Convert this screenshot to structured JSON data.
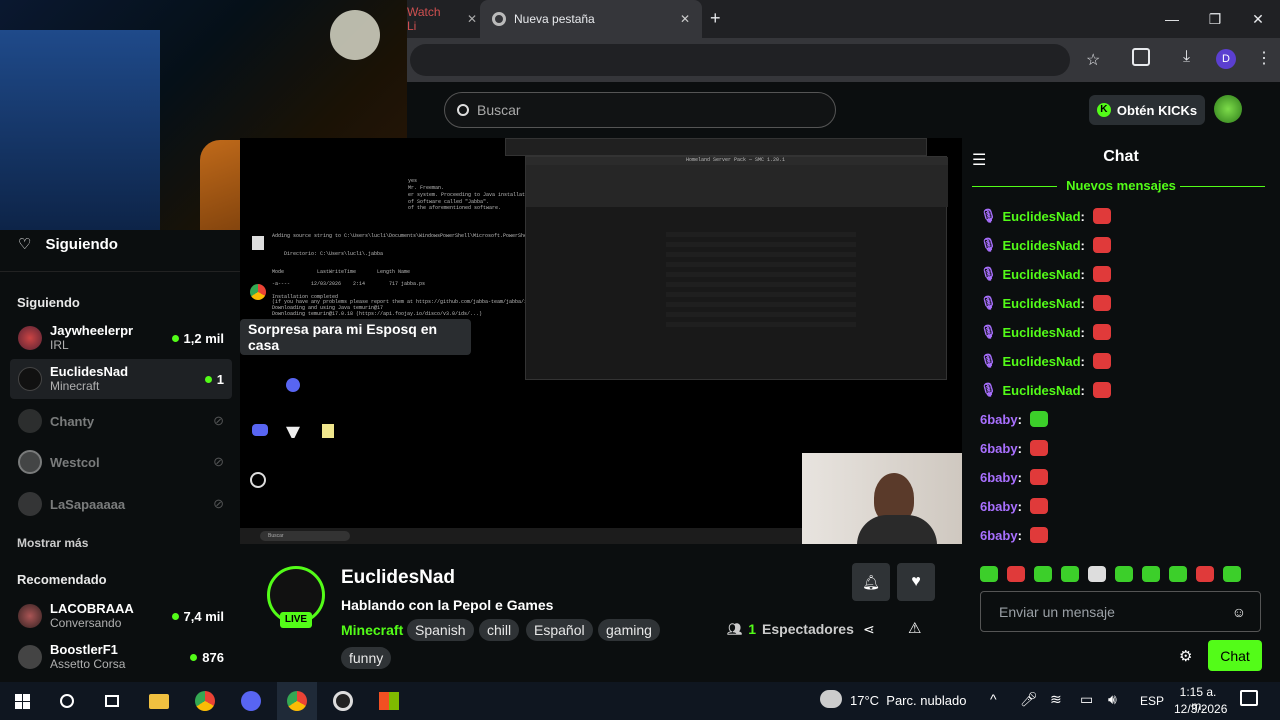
{
  "browser": {
    "tabs": [
      {
        "label": "Watch Li"
      },
      {
        "label": "Nueva pestaña"
      }
    ],
    "profile_initial": "D"
  },
  "header": {
    "search_placeholder": "Buscar",
    "get_kicks_label": "Obtén KICKs"
  },
  "sidebar": {
    "following_header": "Siguiendo",
    "following_section": "Siguiendo",
    "following": [
      {
        "name": "Jaywheelerpr",
        "category": "IRL",
        "viewers": "1,2 mil",
        "live": true
      },
      {
        "name": "EuclidesNad",
        "category": "Minecraft",
        "viewers": "1",
        "live": true
      },
      {
        "name": "Chanty",
        "category": "",
        "viewers": "",
        "live": false
      },
      {
        "name": "Westcol",
        "category": "",
        "viewers": "",
        "live": false
      },
      {
        "name": "LaSapaaaaa",
        "category": "",
        "viewers": "",
        "live": false
      }
    ],
    "show_more": "Mostrar más",
    "recommended_section": "Recomendado",
    "recommended": [
      {
        "name": "LACOBRAAA",
        "category": "Conversando",
        "viewers": "7,4 mil"
      },
      {
        "name": "BoostlerF1",
        "category": "Assetto Corsa",
        "viewers": "876"
      }
    ],
    "tooltip": "Sorpresa para mi Esposq en casa"
  },
  "stream": {
    "terminal_lines": [
      "yes",
      "Mr. Freeman.",
      "er system. Proceeding to Java installation.",
      "of Software called \"Jabba\".",
      "of the aforementioned software.",
      "Adding source string to C:\\Users\\lucli\\Documents\\WindowsPowerShell\\Microsoft.PowerShell_profile.ps1",
      "Directorio: C:\\Users\\lucli\\.jabba",
      "Mode           LastWriteTime       Length Name",
      "-a----       12/03/2026    2:14        717 jabba.ps",
      "Installation completed",
      "(if you have any problems please report them at https://github.com/jabba-team/jabba/issues)",
      "Downloading and using Java temurin@17",
      "Downloading temurin@17.0.18 (https://api.foojay.io/disco/v3.0/ids/...)"
    ],
    "explorer_title": "Homeland Server Pack — SMC 1.20.1",
    "desktop_icons": [
      "KIKEls",
      "Google Chrome",
      "Discord",
      "CurseForge",
      "Homeland Server Pack",
      "Wisoft Connect",
      "TeamViewer"
    ],
    "win_search": "Buscar"
  },
  "channel": {
    "name": "EuclidesNad",
    "live_badge": "LIVE",
    "title": "Hablando con la Pepol e Games",
    "category": "Minecraft",
    "tags": [
      "Spanish",
      "chill",
      "Español",
      "gaming",
      "funny"
    ],
    "viewers_count": "1",
    "viewers_label": "Espectadores"
  },
  "chat": {
    "title": "Chat",
    "new_messages": "Nuevos mensajes",
    "messages": [
      {
        "user": "EuclidesNad",
        "color": "#53fc18",
        "mic": true
      },
      {
        "user": "EuclidesNad",
        "color": "#53fc18",
        "mic": true
      },
      {
        "user": "EuclidesNad",
        "color": "#53fc18",
        "mic": true
      },
      {
        "user": "EuclidesNad",
        "color": "#53fc18",
        "mic": true
      },
      {
        "user": "EuclidesNad",
        "color": "#53fc18",
        "mic": true
      },
      {
        "user": "EuclidesNad",
        "color": "#53fc18",
        "mic": true
      },
      {
        "user": "EuclidesNad",
        "color": "#53fc18",
        "mic": true
      },
      {
        "user": "6baby",
        "color": "#a970ff",
        "mic": false
      },
      {
        "user": "6baby",
        "color": "#a970ff",
        "mic": false
      },
      {
        "user": "6baby",
        "color": "#a970ff",
        "mic": false
      },
      {
        "user": "6baby",
        "color": "#a970ff",
        "mic": false
      },
      {
        "user": "6baby",
        "color": "#a970ff",
        "mic": false
      }
    ],
    "input_placeholder": "Enviar un mensaje",
    "send_label": "Chat"
  },
  "taskbar": {
    "weather": "17°C  Parc. nublado",
    "lang": "ESP",
    "time": "1:15 a. m.",
    "date": "12/3/2026"
  },
  "colors": {
    "accent": "#53fc18",
    "purple": "#a970ff",
    "emote_red": "#e03a3a",
    "emote_green": "#3ccf2a"
  }
}
